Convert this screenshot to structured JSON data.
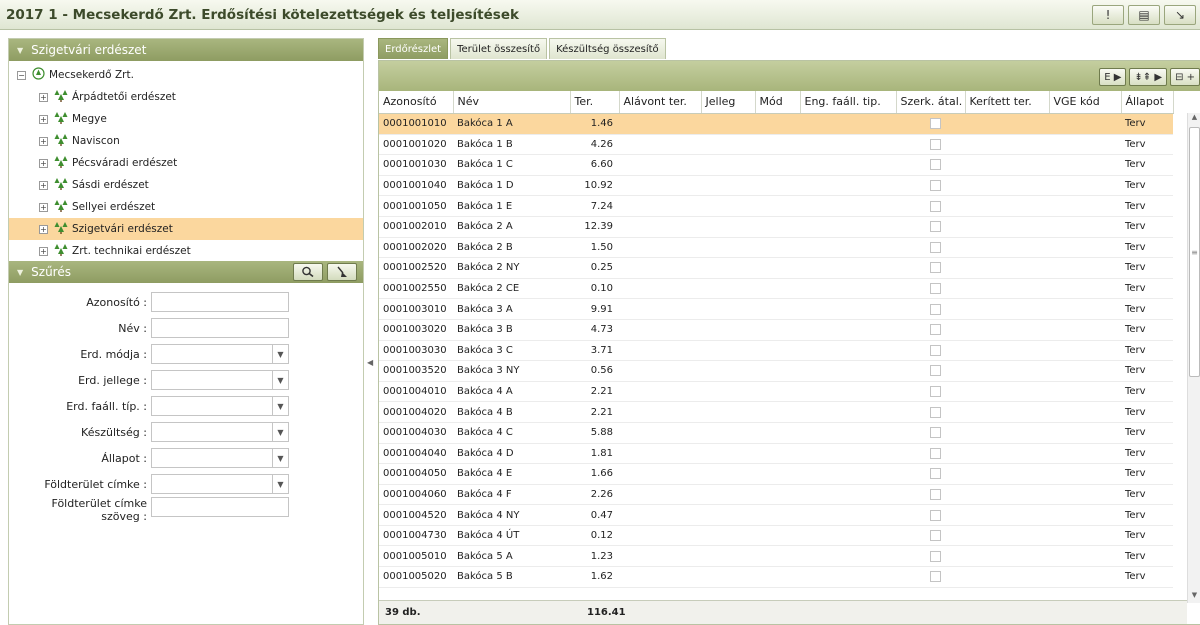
{
  "window": {
    "title": "2017 1 - Mecsekerdő Zrt. Erdősítési kötelezettségek és teljesítések",
    "buttons": [
      "!",
      "▤",
      "↘"
    ]
  },
  "tree_panel": {
    "title": "Szigetvári erdészet",
    "root": "Mecsekerdő Zrt.",
    "items": [
      {
        "label": "Árpádtetői erdészet",
        "selected": false
      },
      {
        "label": "Megye",
        "selected": false
      },
      {
        "label": "Naviscon",
        "selected": false
      },
      {
        "label": "Pécsváradi erdészet",
        "selected": false
      },
      {
        "label": "Sásdi erdészet",
        "selected": false
      },
      {
        "label": "Sellyei erdészet",
        "selected": false
      },
      {
        "label": "Szigetvári erdészet",
        "selected": true
      },
      {
        "label": "Zrt. technikai erdészet",
        "selected": false
      }
    ],
    "expander": "⊞"
  },
  "filter_panel": {
    "title": "Szűrés",
    "fields": [
      {
        "label": "Azonosító :",
        "type": "text",
        "value": ""
      },
      {
        "label": "Név :",
        "type": "text",
        "value": ""
      },
      {
        "label": "Erd. módja :",
        "type": "select",
        "value": ""
      },
      {
        "label": "Erd. jellege :",
        "type": "select",
        "value": ""
      },
      {
        "label": "Erd. faáll. típ. :",
        "type": "select",
        "value": ""
      },
      {
        "label": "Készültség :",
        "type": "select",
        "value": ""
      },
      {
        "label": "Állapot :",
        "type": "select",
        "value": ""
      },
      {
        "label": "Földterület címke :",
        "type": "select",
        "value": ""
      }
    ],
    "last_field": {
      "label_line1": "Földterület címke",
      "label_line2": "szöveg :",
      "value": ""
    }
  },
  "tabs": [
    {
      "label": "Erdőrészlet",
      "active": true
    },
    {
      "label": "Terület összesítő",
      "active": false
    },
    {
      "label": "Készültség összesítő",
      "active": false
    }
  ],
  "grid_toolbar": [
    "E ▶",
    "⇟⇞ ▶",
    "⊟ +"
  ],
  "grid": {
    "columns": [
      "Azonosító",
      "Név",
      "Ter.",
      "Alávont ter.",
      "Jelleg",
      "Mód",
      "Eng. faáll. tip.",
      "Szerk. átal.",
      "Kerített ter.",
      "VGE kód",
      "Állapot"
    ],
    "rows": [
      [
        "0001001010",
        "Bakóca 1 A",
        "1.46",
        "Terv"
      ],
      [
        "0001001020",
        "Bakóca 1 B",
        "4.26",
        "Terv"
      ],
      [
        "0001001030",
        "Bakóca 1 C",
        "6.60",
        "Terv"
      ],
      [
        "0001001040",
        "Bakóca 1 D",
        "10.92",
        "Terv"
      ],
      [
        "0001001050",
        "Bakóca 1 E",
        "7.24",
        "Terv"
      ],
      [
        "0001002010",
        "Bakóca 2 A",
        "12.39",
        "Terv"
      ],
      [
        "0001002020",
        "Bakóca 2 B",
        "1.50",
        "Terv"
      ],
      [
        "0001002520",
        "Bakóca 2 NY",
        "0.25",
        "Terv"
      ],
      [
        "0001002550",
        "Bakóca 2 CE",
        "0.10",
        "Terv"
      ],
      [
        "0001003010",
        "Bakóca 3 A",
        "9.91",
        "Terv"
      ],
      [
        "0001003020",
        "Bakóca 3 B",
        "4.73",
        "Terv"
      ],
      [
        "0001003030",
        "Bakóca 3 C",
        "3.71",
        "Terv"
      ],
      [
        "0001003520",
        "Bakóca 3 NY",
        "0.56",
        "Terv"
      ],
      [
        "0001004010",
        "Bakóca 4 A",
        "2.21",
        "Terv"
      ],
      [
        "0001004020",
        "Bakóca 4 B",
        "2.21",
        "Terv"
      ],
      [
        "0001004030",
        "Bakóca 4 C",
        "5.88",
        "Terv"
      ],
      [
        "0001004040",
        "Bakóca 4 D",
        "1.81",
        "Terv"
      ],
      [
        "0001004050",
        "Bakóca 4 E",
        "1.66",
        "Terv"
      ],
      [
        "0001004060",
        "Bakóca 4 F",
        "2.26",
        "Terv"
      ],
      [
        "0001004520",
        "Bakóca 4 NY",
        "0.47",
        "Terv"
      ],
      [
        "0001004730",
        "Bakóca 4 ÚT",
        "0.12",
        "Terv"
      ],
      [
        "0001005010",
        "Bakóca 5 A",
        "1.23",
        "Terv"
      ],
      [
        "0001005020",
        "Bakóca 5 B",
        "1.62",
        "Terv"
      ]
    ],
    "selected_row": 0,
    "footer": {
      "count": "39 db.",
      "total": "116.41"
    }
  }
}
